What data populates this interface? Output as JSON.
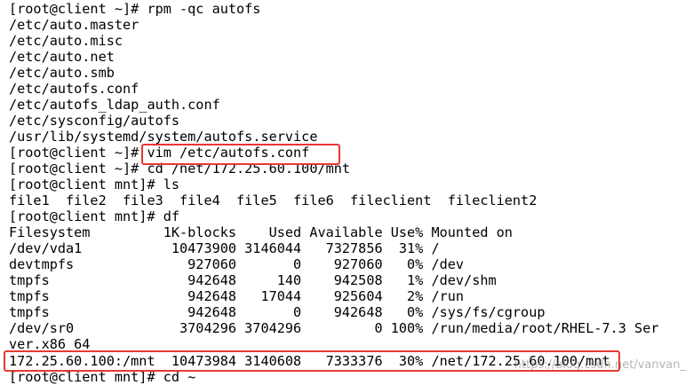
{
  "terminal": {
    "lines": [
      "[root@client ~]# rpm -qc autofs",
      "/etc/auto.master",
      "/etc/auto.misc",
      "/etc/auto.net",
      "/etc/auto.smb",
      "/etc/autofs.conf",
      "/etc/autofs_ldap_auth.conf",
      "/etc/sysconfig/autofs",
      "/usr/lib/systemd/system/autofs.service",
      "[root@client ~]# vim /etc/autofs.conf",
      "[root@client ~]# cd /net/172.25.60.100/mnt",
      "[root@client mnt]# ls",
      "file1  file2  file3  file4  file5  file6  fileclient  fileclient2",
      "[root@client mnt]# df",
      "Filesystem         1K-blocks    Used Available Use% Mounted on",
      "/dev/vda1           10473900 3146044   7327856  31% /",
      "devtmpfs              927060       0    927060   0% /dev",
      "tmpfs                 942648     140    942508   1% /dev/shm",
      "tmpfs                 942648   17044    925604   2% /run",
      "tmpfs                 942648       0    942648   0% /sys/fs/cgroup",
      "/dev/sr0             3704296 3704296         0 100% /run/media/root/RHEL-7.3 Ser",
      "ver.x86_64",
      "172.25.60.100:/mnt  10473984 3140608   7333376  30% /net/172.25.60.100/mnt",
      "[root@client mnt]# cd ~"
    ],
    "watermark": "https://blog.csdn.net/vanvan_"
  },
  "colors": {
    "background": "#ffffff",
    "text": "#000000",
    "highlight": "#e53935"
  }
}
